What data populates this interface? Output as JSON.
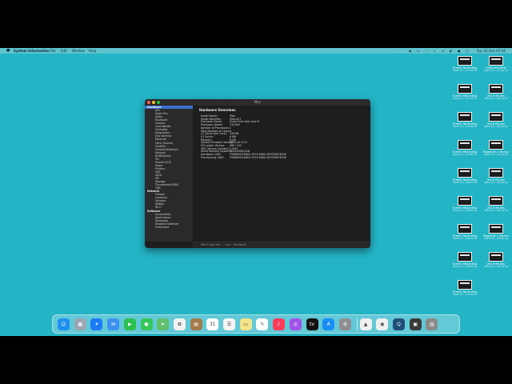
{
  "menubar": {
    "app_name": "System Information",
    "menus": [
      "File",
      "Edit",
      "Window",
      "Help"
    ],
    "clock": "Sun 31 Dec 07:44"
  },
  "window": {
    "title": "Mac",
    "content_title": "Hardware Overview:",
    "status_path": "Mac's own Mac … user › Hardware"
  },
  "sidebar": {
    "items": [
      {
        "label": "Hardware",
        "type": "h"
      },
      {
        "label": "ATA",
        "type": "c"
      },
      {
        "label": "Apple Pay",
        "type": "c"
      },
      {
        "label": "Audio",
        "type": "c"
      },
      {
        "label": "Bluetooth",
        "type": "c"
      },
      {
        "label": "Camera",
        "type": "c"
      },
      {
        "label": "Card Reader",
        "type": "c"
      },
      {
        "label": "Controller",
        "type": "c"
      },
      {
        "label": "Diagnostics",
        "type": "c"
      },
      {
        "label": "Disc Burning",
        "type": "c"
      },
      {
        "label": "Ethernet",
        "type": "c"
      },
      {
        "label": "Fibre Channel",
        "type": "c"
      },
      {
        "label": "FireWire",
        "type": "c"
      },
      {
        "label": "Graphics/Displays",
        "type": "c"
      },
      {
        "label": "Memory",
        "type": "c"
      },
      {
        "label": "NVMExpress",
        "type": "c"
      },
      {
        "label": "PCI",
        "type": "c"
      },
      {
        "label": "Parallel SCSI",
        "type": "c"
      },
      {
        "label": "Power",
        "type": "c"
      },
      {
        "label": "Printers",
        "type": "c"
      },
      {
        "label": "SAS",
        "type": "c"
      },
      {
        "label": "SATA",
        "type": "c"
      },
      {
        "label": "SPI",
        "type": "c"
      },
      {
        "label": "Storage",
        "type": "c"
      },
      {
        "label": "Thunderbolt/USB4",
        "type": "c"
      },
      {
        "label": "USB",
        "type": "c"
      },
      {
        "label": "Network",
        "type": "h"
      },
      {
        "label": "Firewall",
        "type": "c"
      },
      {
        "label": "Locations",
        "type": "c"
      },
      {
        "label": "Volumes",
        "type": "c"
      },
      {
        "label": "WWAN",
        "type": "c"
      },
      {
        "label": "Wi-Fi",
        "type": "c"
      },
      {
        "label": "Software",
        "type": "h"
      },
      {
        "label": "Accessibility",
        "type": "c"
      },
      {
        "label": "Applications",
        "type": "c"
      },
      {
        "label": "Developer",
        "type": "c"
      },
      {
        "label": "Disabled Software",
        "type": "c"
      },
      {
        "label": "Extensions",
        "type": "c"
      }
    ]
  },
  "overview": {
    "rows": [
      {
        "k": "Model Name:",
        "v": "iMac"
      },
      {
        "k": "Model Identifier:",
        "v": "iMac18,2"
      },
      {
        "k": "Processor Name:",
        "v": "Quad-Core Intel Core i5"
      },
      {
        "k": "Processor Speed:",
        "v": "3.6 GHz"
      },
      {
        "k": "Number of Processors:",
        "v": "1"
      },
      {
        "k": "Total Number of Cores:",
        "v": "4"
      },
      {
        "k": "L2 Cache (per Core):",
        "v": "256 KB"
      },
      {
        "k": "L3 Cache:",
        "v": "6 MB"
      },
      {
        "k": "Memory:",
        "v": "8 GB"
      },
      {
        "k": "System Firmware Version:",
        "v": "2020.40.3.0.0"
      },
      {
        "k": "OS Loader Version:",
        "v": "580~102"
      },
      {
        "k": "SMC Version (system):",
        "v": "2.40f1"
      },
      {
        "k": "Serial Number (system):",
        "v": "C02XXXXXJ1GN"
      },
      {
        "k": "Hardware UUID:",
        "v": "F5DBB420-8D02-5F15-8080-3D7E265C834E"
      },
      {
        "k": "Provisioning UDID:",
        "v": "F5DBB420-8D02-5F15-8080-3D7E265C834E"
      }
    ]
  },
  "desktop": {
    "icons": [
      {
        "label": "Screen Recording",
        "sub": "2023-12-...07.22.54"
      },
      {
        "label": "LiftScreenShot",
        "sub": "2023-12-...11.06.17"
      },
      {
        "label": "Screen Recording",
        "sub": "2023-12-...07.25.27"
      },
      {
        "label": "Zrzut ekranu",
        "sub": "2023-12-...08.21.17"
      },
      {
        "label": "Screen Recording",
        "sub": "2023-12-...07.49.58"
      },
      {
        "label": "Zrzut ekranu",
        "sub": "2023-12-...08.42.55"
      },
      {
        "label": "Screen Recording",
        "sub": "2023-12-...07.50.57"
      },
      {
        "label": "Nagranie z ekranu",
        "sub": "2023-12-...12.45.57"
      },
      {
        "label": "Screen Recording",
        "sub": "2023-12-...08.07.06"
      },
      {
        "label": "Zrzut ekranu",
        "sub": "2023-12-...08.46.02"
      },
      {
        "label": "Screen Recording",
        "sub": "2023-12-...08.35.42"
      },
      {
        "label": "Zrzut ekranu",
        "sub": "2023-12-...09.14.01"
      },
      {
        "label": "Screen Recording",
        "sub": "2023-12-...09.15.16"
      },
      {
        "label": "Nagranie z ekranu",
        "sub": "2023-12-...09.43.14"
      },
      {
        "label": "Screen Recording",
        "sub": "2023-12-...09.50.58"
      },
      {
        "label": "Zrzut ekranu",
        "sub": "2023-12-...09.43.04"
      },
      {
        "label": "Screen Recording",
        "sub": "2023-12-...07.42.04"
      }
    ]
  },
  "dock": {
    "apps": [
      {
        "name": "Finder",
        "color": "#1f8ff0",
        "glyph": "☺"
      },
      {
        "name": "Launchpad",
        "color": "#9aa6b3",
        "glyph": "▦"
      },
      {
        "name": "Safari",
        "color": "#1d7bf5",
        "glyph": "✦"
      },
      {
        "name": "Mail",
        "color": "#3b92f0",
        "glyph": "✉"
      },
      {
        "name": "FaceTime",
        "color": "#2cc14f",
        "glyph": "▶"
      },
      {
        "name": "Messages",
        "color": "#35c759",
        "glyph": "●"
      },
      {
        "name": "Maps",
        "color": "#5fbf6b",
        "glyph": "➤"
      },
      {
        "name": "Photos",
        "color": "#f2f2f2",
        "glyph": "✿"
      },
      {
        "name": "Notes",
        "color": "#a37a4b",
        "glyph": "▤"
      },
      {
        "name": "Calendar",
        "color": "#ffffff",
        "glyph": "31"
      },
      {
        "name": "Reminders",
        "color": "#f5f5f5",
        "glyph": "☰"
      },
      {
        "name": "Stickies",
        "color": "#f5e38a",
        "glyph": "▭"
      },
      {
        "name": "Freeform",
        "color": "#ffffff",
        "glyph": "✎"
      },
      {
        "name": "Music",
        "color": "#fb3c5a",
        "glyph": "♪"
      },
      {
        "name": "Podcasts",
        "color": "#a154e8",
        "glyph": "◎"
      },
      {
        "name": "Apple TV",
        "color": "#111111",
        "glyph": "tv"
      },
      {
        "name": "App Store",
        "color": "#1a8ef5",
        "glyph": "A"
      },
      {
        "name": "System Settings",
        "color": "#8e8e93",
        "glyph": "⚙"
      },
      {
        "name": "Preview",
        "color": "#f0f0f0",
        "glyph": "▲"
      },
      {
        "name": "Chrome",
        "color": "#f0f0f0",
        "glyph": "◉"
      },
      {
        "name": "QuickTime",
        "color": "#1f4f7a",
        "glyph": "Q"
      },
      {
        "name": "Downloads",
        "color": "#3a3a3a",
        "glyph": "▣"
      },
      {
        "name": "Trash",
        "color": "#8a8a8a",
        "glyph": "▥"
      }
    ]
  }
}
